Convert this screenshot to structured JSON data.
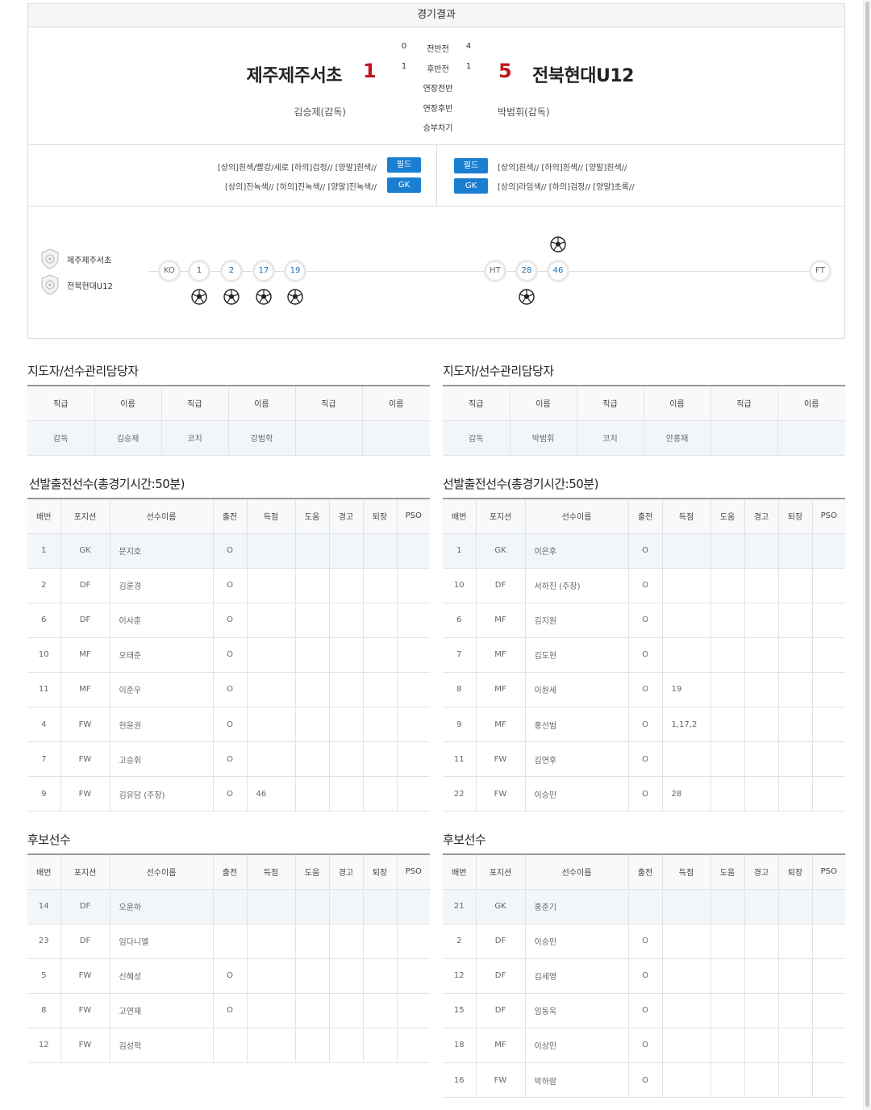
{
  "header": {
    "title": "경기결과"
  },
  "match": {
    "home": {
      "name": "제주제주서초",
      "score": "1",
      "coach": "김승제(감독)",
      "uniform_field": "[상의]흰색/빨강/세로 [하의]검정// [양말]흰색//",
      "uniform_gk": "[상의]진녹색// [하의]진녹색// [양말]진녹색//"
    },
    "away": {
      "name": "전북현대U12",
      "score": "5",
      "coach": "박범휘(감독)",
      "uniform_field": "[상의]흰색// [하의]흰색// [양말]흰색//",
      "uniform_gk": "[상의]라임색// [하의]검정// [양말]초록//"
    },
    "periods": [
      {
        "label": "전반전",
        "home": "0",
        "away": "4"
      },
      {
        "label": "후반전",
        "home": "1",
        "away": "1"
      },
      {
        "label": "연장전반",
        "home": "",
        "away": ""
      },
      {
        "label": "연장후반",
        "home": "",
        "away": ""
      },
      {
        "label": "승부차기",
        "home": "",
        "away": ""
      }
    ],
    "btn_field": "필드",
    "btn_gk": "GK"
  },
  "timeline": {
    "home_team": "제주제주서초",
    "away_team": "전북현대U12",
    "ko": "KO",
    "ht": "HT",
    "ft": "FT",
    "first_half_goals": [
      "1",
      "2",
      "17",
      "19"
    ],
    "second_half_goals": [
      "28",
      "46"
    ],
    "ball_icon": "soccer-ball-icon",
    "shield_icon": "team-emblem-icon"
  },
  "staff": {
    "title": "지도자/선수관리담당자",
    "headers": [
      "직급",
      "이름",
      "직급",
      "이름",
      "직급",
      "이름"
    ],
    "home": [
      "감독",
      "김승제",
      "코치",
      "강범학",
      "",
      ""
    ],
    "away": [
      "감독",
      "박범휘",
      "코치",
      "안흥재",
      "",
      ""
    ]
  },
  "starters": {
    "title": "선발출전선수(총경기시간:50분)",
    "headers": [
      "배번",
      "포지션",
      "선수이름",
      "출전",
      "득점",
      "도움",
      "경고",
      "퇴장",
      "PSO"
    ],
    "home": [
      [
        "1",
        "GK",
        "문지호",
        "O",
        "",
        "",
        "",
        "",
        ""
      ],
      [
        "2",
        "DF",
        "김륜경",
        "O",
        "",
        "",
        "",
        "",
        ""
      ],
      [
        "6",
        "DF",
        "이사훈",
        "O",
        "",
        "",
        "",
        "",
        ""
      ],
      [
        "10",
        "MF",
        "오태준",
        "O",
        "",
        "",
        "",
        "",
        ""
      ],
      [
        "11",
        "MF",
        "이준우",
        "O",
        "",
        "",
        "",
        "",
        ""
      ],
      [
        "4",
        "FW",
        "현윤권",
        "O",
        "",
        "",
        "",
        "",
        ""
      ],
      [
        "7",
        "FW",
        "고승휘",
        "O",
        "",
        "",
        "",
        "",
        ""
      ],
      [
        "9",
        "FW",
        "김유담 (주장)",
        "O",
        "46",
        "",
        "",
        "",
        ""
      ]
    ],
    "away": [
      [
        "1",
        "GK",
        "이은후",
        "O",
        "",
        "",
        "",
        "",
        ""
      ],
      [
        "10",
        "DF",
        "서하진 (주장)",
        "O",
        "",
        "",
        "",
        "",
        ""
      ],
      [
        "6",
        "MF",
        "김지원",
        "O",
        "",
        "",
        "",
        "",
        ""
      ],
      [
        "7",
        "MF",
        "김도현",
        "O",
        "",
        "",
        "",
        "",
        ""
      ],
      [
        "8",
        "MF",
        "이원세",
        "O",
        "19",
        "",
        "",
        "",
        ""
      ],
      [
        "9",
        "MF",
        "홍선범",
        "O",
        "1,17,2",
        "",
        "",
        "",
        ""
      ],
      [
        "11",
        "FW",
        "김연후",
        "O",
        "",
        "",
        "",
        "",
        ""
      ],
      [
        "22",
        "FW",
        "이승민",
        "O",
        "28",
        "",
        "",
        "",
        ""
      ]
    ]
  },
  "subs": {
    "title": "후보선수",
    "headers": [
      "배번",
      "포지션",
      "선수이름",
      "출전",
      "득점",
      "도움",
      "경고",
      "퇴장",
      "PSO"
    ],
    "home": [
      [
        "14",
        "DF",
        "오윤하",
        "",
        "",
        "",
        "",
        "",
        ""
      ],
      [
        "23",
        "DF",
        "임다니엘",
        "",
        "",
        "",
        "",
        "",
        ""
      ],
      [
        "5",
        "FW",
        "신혜성",
        "O",
        "",
        "",
        "",
        "",
        ""
      ],
      [
        "8",
        "FW",
        "고연재",
        "O",
        "",
        "",
        "",
        "",
        ""
      ],
      [
        "12",
        "FW",
        "김성혁",
        "",
        "",
        "",
        "",
        "",
        ""
      ]
    ],
    "away": [
      [
        "21",
        "GK",
        "홍준기",
        "",
        "",
        "",
        "",
        "",
        ""
      ],
      [
        "2",
        "DF",
        "이승민",
        "O",
        "",
        "",
        "",
        "",
        ""
      ],
      [
        "12",
        "DF",
        "김세영",
        "O",
        "",
        "",
        "",
        "",
        ""
      ],
      [
        "15",
        "DF",
        "임동욱",
        "O",
        "",
        "",
        "",
        "",
        ""
      ],
      [
        "18",
        "MF",
        "이상민",
        "O",
        "",
        "",
        "",
        "",
        ""
      ],
      [
        "16",
        "FW",
        "박하람",
        "O",
        "",
        "",
        "",
        "",
        ""
      ]
    ]
  }
}
